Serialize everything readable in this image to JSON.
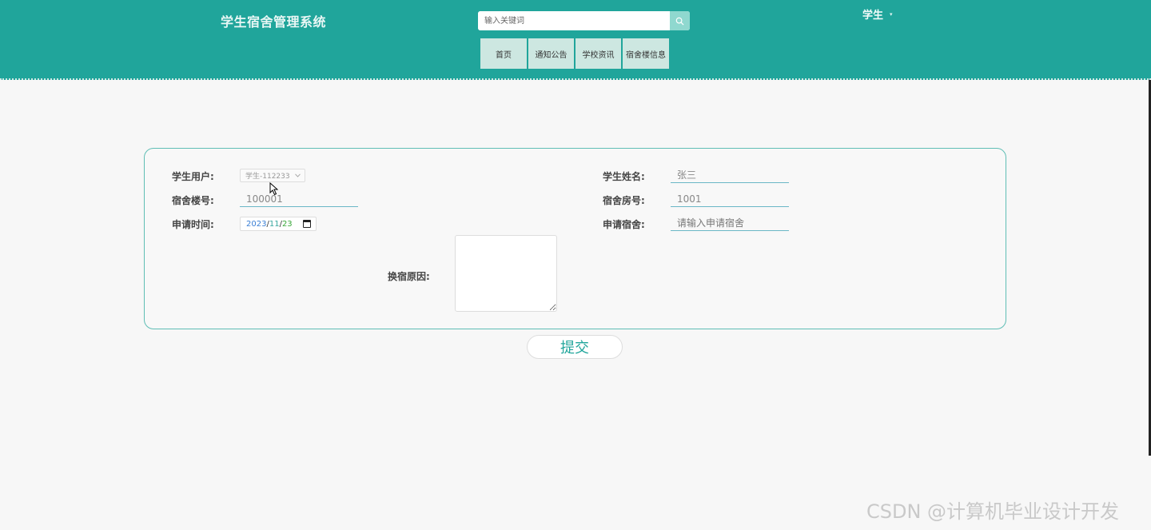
{
  "header": {
    "site_title": "学生宿舍管理系统",
    "search_placeholder": "输入关键词",
    "user_label": "学生",
    "user_caret": "▾"
  },
  "nav": {
    "items": [
      {
        "label": "首页"
      },
      {
        "label": "通知公告"
      },
      {
        "label": "学校资讯"
      },
      {
        "label": "宿舍楼信息"
      }
    ]
  },
  "form": {
    "student_user_label": "学生用户:",
    "student_user_value": "学生-112233",
    "student_name_label": "学生姓名:",
    "student_name_value": "张三",
    "building_no_label": "宿舍楼号:",
    "building_no_value": "100001",
    "room_no_label": "宿舍房号:",
    "room_no_value": "1001",
    "apply_time_label": "申请时间:",
    "apply_time_year": "2023",
    "apply_time_month": "11",
    "apply_time_day": "23",
    "apply_dorm_label": "申请宿舍:",
    "apply_dorm_placeholder": "请输入申请宿舍",
    "reason_label": "换宿原因:",
    "reason_value": ""
  },
  "submit_label": "提交",
  "watermark": "CSDN @计算机毕业设计开发",
  "icons": {
    "search": "search-icon",
    "calendar": "calendar-icon",
    "dropdown": "chevron-down-icon"
  },
  "colors": {
    "brand": "#20a59b",
    "nav_bg": "#cde7e1",
    "card_border": "#5fbeb5"
  }
}
